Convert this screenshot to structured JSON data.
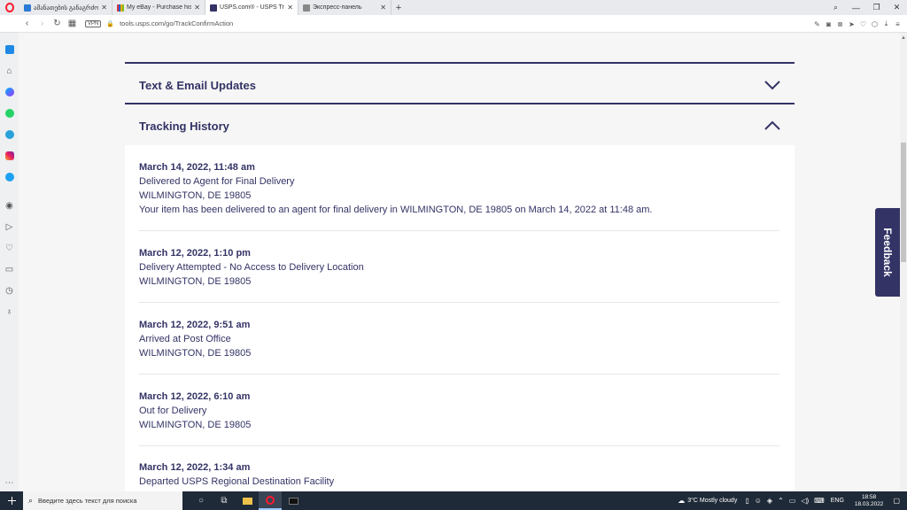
{
  "browser": {
    "tabs": [
      {
        "title": "ამანათების განაგრძობ...",
        "favicon_color": "#2b7bd6"
      },
      {
        "title": "My eBay - Purchase history",
        "favicon_color": "#e53238"
      },
      {
        "title": "USPS.com® - USPS Tracking",
        "favicon_color": "#333366"
      },
      {
        "title": "Экспресс-панель",
        "favicon_color": "#888888"
      }
    ],
    "new_tab": "+",
    "url": "tools.usps.com/go/TrackConfirmAction",
    "vpn_label": "VPN"
  },
  "sections": {
    "email_updates": "Text & Email Updates",
    "tracking_history": "Tracking History"
  },
  "events": [
    {
      "when": "March 14, 2022, 11:48 am",
      "status": "Delivered to Agent for Final Delivery",
      "location": "WILMINGTON, DE 19805",
      "detail": "Your item has been delivered to an agent for final delivery in WILMINGTON, DE 19805 on March 14, 2022 at 11:48 am."
    },
    {
      "when": "March 12, 2022, 1:10 pm",
      "status": "Delivery Attempted - No Access to Delivery Location",
      "location": "WILMINGTON, DE 19805"
    },
    {
      "when": "March 12, 2022, 9:51 am",
      "status": "Arrived at Post Office",
      "location": "WILMINGTON, DE 19805"
    },
    {
      "when": "March 12, 2022, 6:10 am",
      "status": "Out for Delivery",
      "location": "WILMINGTON, DE 19805"
    },
    {
      "when": "March 12, 2022, 1:34 am",
      "status": "Departed USPS Regional Destination Facility"
    }
  ],
  "feedback_label": "Feedback",
  "taskbar": {
    "search_placeholder": "Введите здесь текст для поиска",
    "weather": "3°C  Mostly cloudy",
    "language": "ENG",
    "time": "18:58",
    "date": "18.03.2022"
  },
  "colors": {
    "brand": "#333366",
    "page_bg": "#f6f6f6"
  }
}
